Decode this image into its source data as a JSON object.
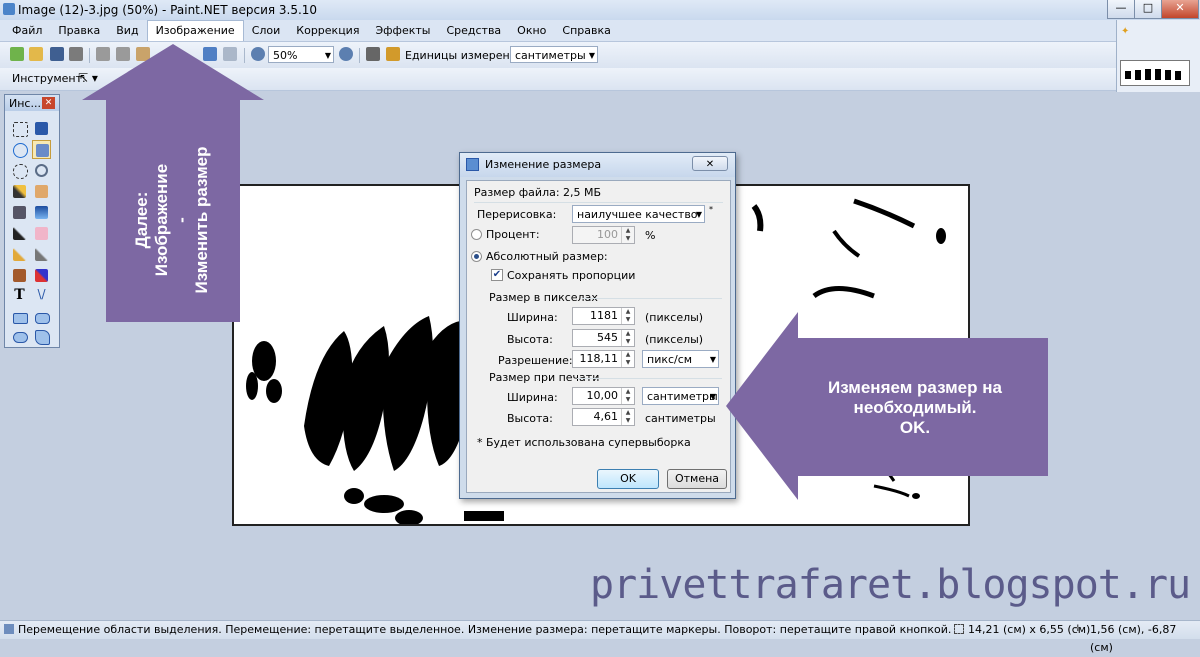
{
  "window": {
    "title": "Image (12)-3.jpg (50%) - Paint.NET версия 3.5.10",
    "min_glyph": "—",
    "max_glyph": "□",
    "close_glyph": "✕"
  },
  "menu": [
    "Файл",
    "Правка",
    "Вид",
    "Изображение",
    "Слои",
    "Коррекция",
    "Эффекты",
    "Средства",
    "Окно",
    "Справка"
  ],
  "toolbar": {
    "zoom_value": "50%",
    "units_label": "Единицы измерения:",
    "units_value": "сантиметры",
    "tool_label": "Инструмент:"
  },
  "tools_window": {
    "title": "Инс..."
  },
  "dialog": {
    "title": "Изменение размера",
    "file_size": "Размер файла: 2,5 МБ",
    "resampling_label": "Перерисовка:",
    "resampling_value": "наилучшее качество",
    "percent_label": "Процент:",
    "percent_value": "100",
    "percent_unit": "%",
    "absolute_label": "Абсолютный размер:",
    "keep_ratio_label": "Сохранять пропорции",
    "pixel_group": "Размер в пикселах",
    "width_label": "Ширина:",
    "height_label": "Высота:",
    "resolution_label": "Разрешение:",
    "px_width": "1181",
    "px_height": "545",
    "px_unit": "(пикселы)",
    "resolution_value": "118,11",
    "resolution_unit": "пикс/см",
    "print_group": "Размер при печати",
    "print_width": "10,00",
    "print_height": "4,61",
    "print_width_unit": "сантиметры",
    "print_height_unit": "сантиметры",
    "note": "* Будет использована супервыборка",
    "ok": "OK",
    "cancel": "Отмена"
  },
  "annotations": {
    "up_arrow_text": [
      "Далее:",
      "Изображение",
      "-",
      "Изменить размер"
    ],
    "left_arrow_text": [
      "Изменяем размер на",
      "необходимый.",
      "OK."
    ],
    "arrow_color": "#7d68a3"
  },
  "watermark": "privettrafaret.blogspot.ru",
  "status": {
    "message": "Перемещение области выделения. Перемещение: перетащите выделенное. Изменение размера: перетащите маркеры. Поворот: перетащите правой кнопкой.",
    "size": "14,21 (см) x 6,55 (см)",
    "cursor": "1,56 (см), -6,87 (см)"
  }
}
